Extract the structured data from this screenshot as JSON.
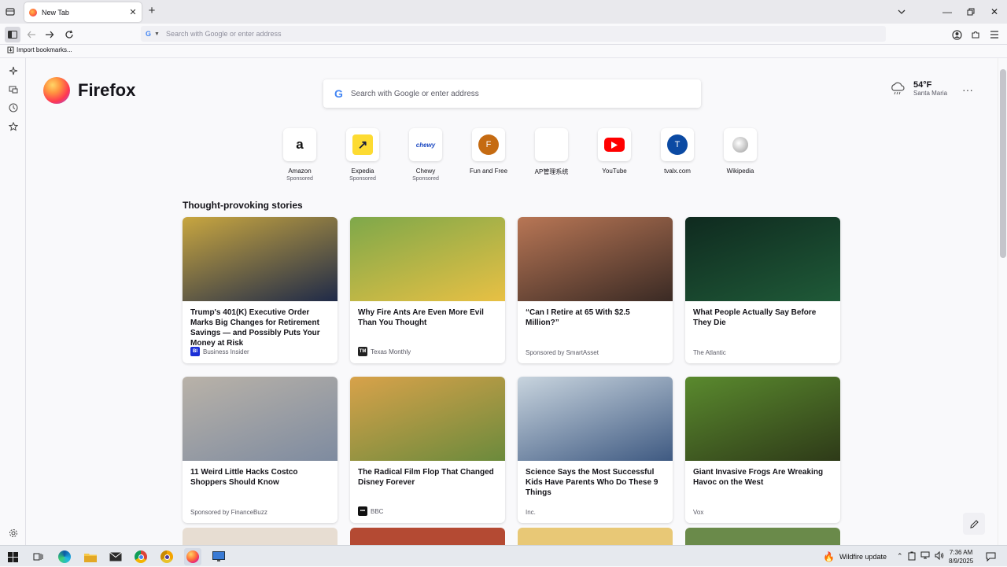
{
  "browser": {
    "tab_title": "New Tab",
    "address_placeholder": "Search with Google or enter address",
    "import_bookmarks": "Import bookmarks..."
  },
  "newtab": {
    "logo_text": "Firefox",
    "search_placeholder": "Search with Google or enter address",
    "weather": {
      "temp": "54°F",
      "city": "Santa Maria"
    },
    "top_sites": [
      {
        "name": "Amazon",
        "sponsored": "Sponsored",
        "icon": "amazon-icon"
      },
      {
        "name": "Expedia",
        "sponsored": "Sponsored",
        "icon": "expedia-icon"
      },
      {
        "name": "Chewy",
        "sponsored": "Sponsored",
        "icon": "chewy-icon"
      },
      {
        "name": "Fun and Free",
        "sponsored": "",
        "letter": "F",
        "icon": "letter-f-icon"
      },
      {
        "name": "AP管理系统",
        "sponsored": "",
        "icon": "blank-site-icon"
      },
      {
        "name": "YouTube",
        "sponsored": "",
        "icon": "youtube-icon"
      },
      {
        "name": "tvalx.com",
        "sponsored": "",
        "letter": "T",
        "icon": "letter-t-icon"
      },
      {
        "name": "Wikipedia",
        "sponsored": "",
        "icon": "wikipedia-icon"
      }
    ],
    "section_title": "Thought-provoking stories",
    "stories": [
      {
        "headline": "Trump's 401(K) Executive Order Marks Big Changes for Retirement Savings — and Possibly Puts Your Money at Risk",
        "source": "Business Insider",
        "badge": "BI",
        "badge_color": "#1a2fd6",
        "img_colors": [
          "#c8a640",
          "#1f2a48"
        ]
      },
      {
        "headline": "Why Fire Ants Are Even More Evil Than You Thought",
        "source": "Texas Monthly",
        "badge": "TM",
        "badge_color": "#222222",
        "img_colors": [
          "#7ea84a",
          "#e8c044"
        ]
      },
      {
        "headline": "“Can I Retire at 65 With $2.5 Million?”",
        "source": "Sponsored by SmartAsset",
        "badge": "",
        "badge_color": "",
        "img_colors": [
          "#b87655",
          "#3a2a24"
        ]
      },
      {
        "headline": "What People Actually Say Before They Die",
        "source": "The Atlantic",
        "badge": "",
        "badge_color": "",
        "img_colors": [
          "#0f2a1f",
          "#1f5a38"
        ]
      },
      {
        "headline": "11 Weird Little Hacks Costco Shoppers Should Know",
        "source": "Sponsored by FinanceBuzz",
        "badge": "",
        "badge_color": "",
        "img_colors": [
          "#b9b2a8",
          "#7e8ba0"
        ]
      },
      {
        "headline": "The Radical Film Flop That Changed Disney Forever",
        "source": "BBC",
        "badge": "•••",
        "badge_color": "#111111",
        "img_colors": [
          "#d8a24a",
          "#6b8a3c"
        ]
      },
      {
        "headline": "Science Says the Most Successful Kids Have Parents Who Do These 9 Things",
        "source": "Inc.",
        "badge": "",
        "badge_color": "",
        "img_colors": [
          "#c8d4de",
          "#3f5a82"
        ]
      },
      {
        "headline": "Giant Invasive Frogs Are Wreaking Havoc on the West",
        "source": "Vox",
        "badge": "",
        "badge_color": "",
        "img_colors": [
          "#5a8a2e",
          "#2e3a18"
        ]
      }
    ],
    "partial_colors": [
      "#e7ddd2",
      "#b44a33",
      "#e8c876",
      "#6a8a4a"
    ]
  },
  "taskbar": {
    "wildfire": "Wildfire update",
    "time": "7:36 AM",
    "date": "8/9/2025"
  }
}
